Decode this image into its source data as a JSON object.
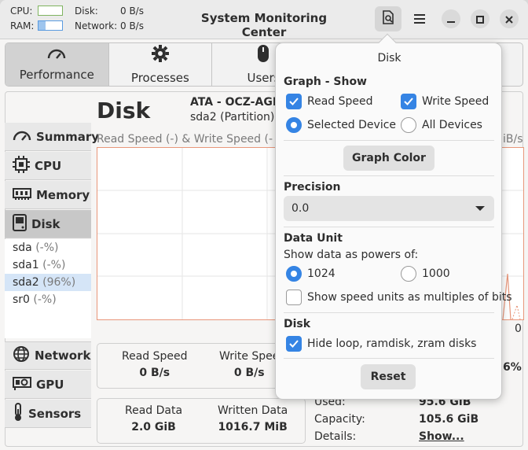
{
  "header": {
    "cpu_label": "CPU:",
    "ram_label": "RAM:",
    "disk_label": "Disk:",
    "disk_value": "0 B/s",
    "network_label": "Network:",
    "network_value": "0 B/s",
    "cpu_level": 0.0,
    "ram_level": 0.3,
    "title": "System Monitoring Center"
  },
  "tabs": [
    {
      "label": "Performance",
      "icon": "speedometer-icon"
    },
    {
      "label": "Processes",
      "icon": "gear-icon"
    },
    {
      "label": "Users",
      "icon": "mouse-icon"
    }
  ],
  "sidebar": {
    "items": [
      {
        "label": "Summary",
        "icon": "speedometer-icon"
      },
      {
        "label": "CPU",
        "icon": "cpu-icon"
      },
      {
        "label": "Memory",
        "icon": "memory-icon"
      },
      {
        "label": "Disk",
        "icon": "disk-icon"
      },
      {
        "label": "Network",
        "icon": "globe-icon"
      },
      {
        "label": "GPU",
        "icon": "gpu-icon"
      },
      {
        "label": "Sensors",
        "icon": "thermometer-icon"
      }
    ],
    "devices": [
      {
        "name": "sda",
        "pct": "(-%)"
      },
      {
        "name": "sda1",
        "pct": "(-%)"
      },
      {
        "name": "sda2",
        "pct": "(96%)"
      },
      {
        "name": "sr0",
        "pct": "(-%)"
      }
    ]
  },
  "disk": {
    "title": "Disk",
    "model": "ATA - OCZ-AGIL",
    "partition": "sda2  (Partition)",
    "graph_label": "Read Speed (-) & Write Speed (-  -)",
    "graph_unit_partial": "iB/s",
    "graph_zero": "0",
    "read_speed_label": "Read Speed",
    "read_speed_value": "0 B/s",
    "write_speed_label": "Write Spee",
    "write_speed_value": "0 B/s",
    "usage_partial": "6%",
    "read_data_label": "Read Data",
    "read_data_value": "2.0 GiB",
    "written_data_label": "Written Data",
    "written_data_value": "1016.7 MiB",
    "used_label": "Used:",
    "used_value": "95.6 GiB",
    "capacity_label": "Capacity:",
    "capacity_value": "105.6 GiB",
    "details_label": "Details:",
    "details_value": "Show..."
  },
  "popover": {
    "title": "Disk",
    "graph_show_heading": "Graph - Show",
    "read_speed": "Read Speed",
    "write_speed": "Write Speed",
    "selected_device": "Selected Device",
    "all_devices": "All Devices",
    "graph_color": "Graph Color",
    "precision_heading": "Precision",
    "precision_value": "0.0",
    "data_unit_heading": "Data Unit",
    "powers_label": "Show data as powers of:",
    "opt_1024": "1024",
    "opt_1000": "1000",
    "bits_label": "Show speed units as multiples of bits",
    "disk_heading": "Disk",
    "hide_loop": "Hide loop, ramdisk, zram disks",
    "reset": "Reset"
  },
  "colors": {
    "accent": "#3584e4",
    "graph_border": "#e8967a",
    "selected_row": "#d5e5f7"
  }
}
